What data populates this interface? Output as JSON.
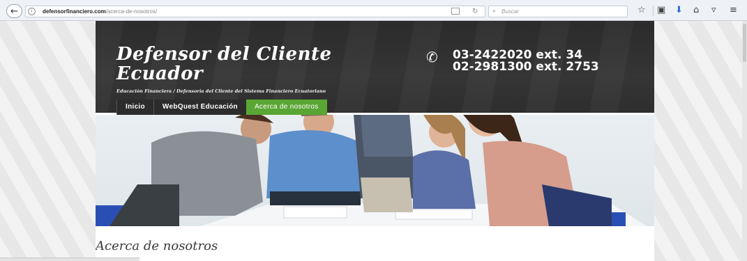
{
  "browser": {
    "url_host": "defensorfinanciero.com",
    "url_path": "/acerca-de-nosotros/",
    "search_placeholder": "Buscar"
  },
  "site": {
    "title": "Defensor del Cliente Ecuador",
    "tagline": "Educación Financiera / Defensoría del Cliente del Sistema Financiero Ecuatoriano",
    "phones": [
      "03-2422020 ext. 34",
      "02-2981300 ext. 2753"
    ],
    "nav": [
      {
        "label": "Inicio",
        "active": false
      },
      {
        "label": "WebQuest Educación",
        "active": false
      },
      {
        "label": "Acerca de nosotros",
        "active": true
      }
    ],
    "active_color": "#5aa634",
    "header_color": "#2e2e2e"
  },
  "page": {
    "heading": "Acerca de nosotros"
  }
}
